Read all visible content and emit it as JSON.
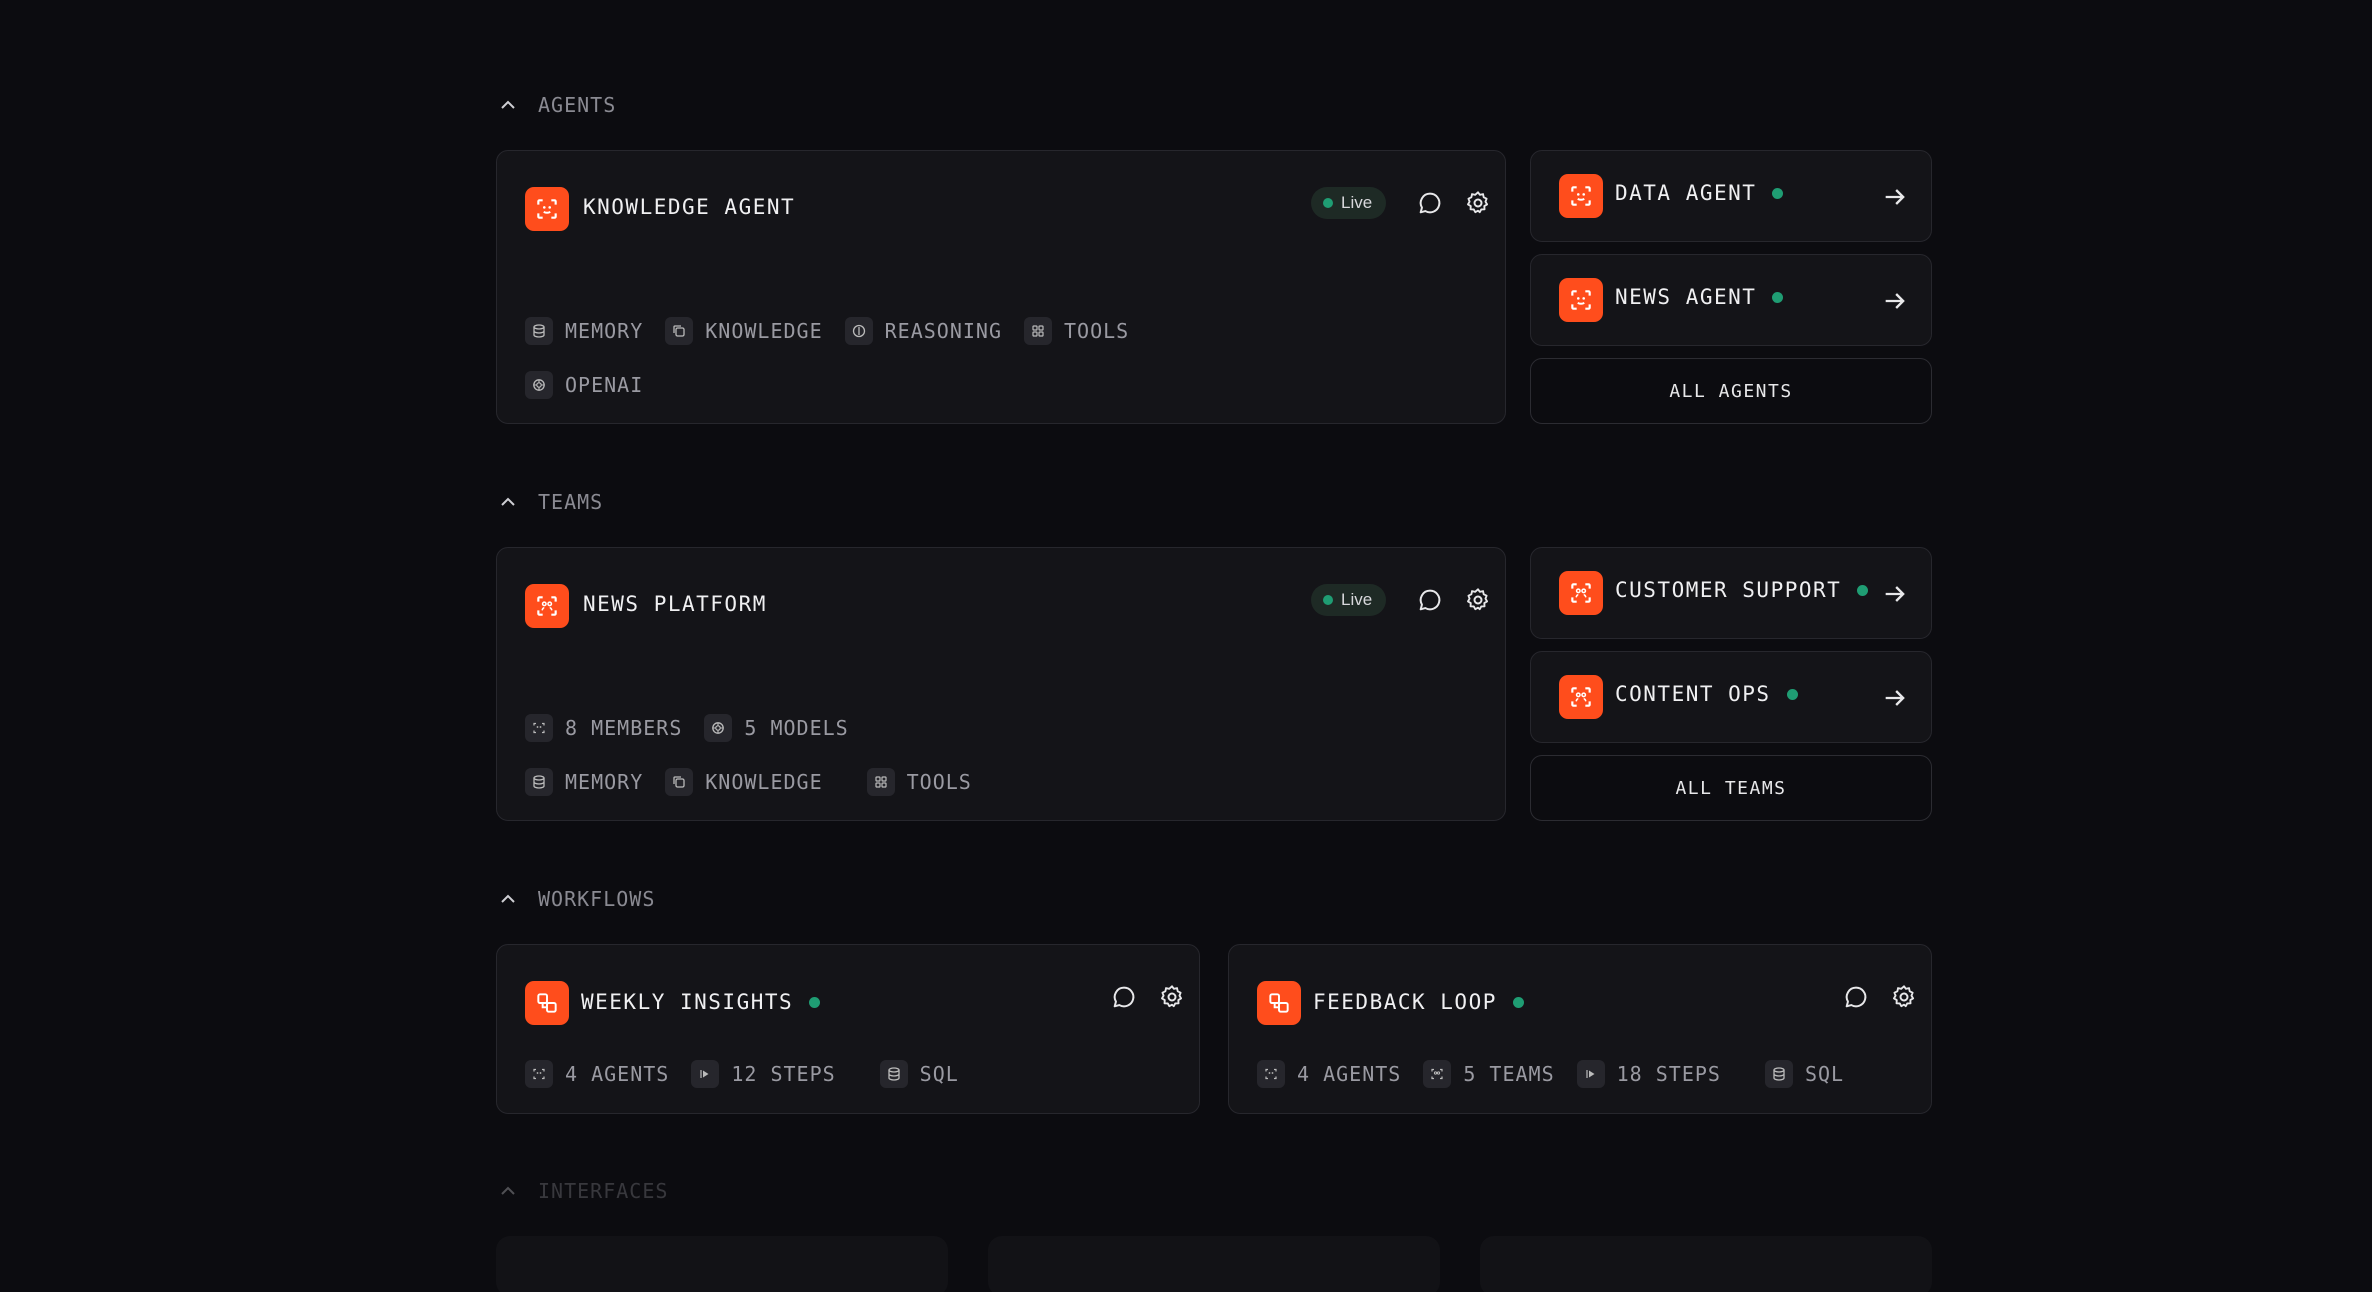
{
  "agents": {
    "section_label": "AGENTS",
    "main": {
      "title": "KNOWLEDGE AGENT",
      "status": "Live",
      "tags": [
        "MEMORY",
        "KNOWLEDGE",
        "REASONING",
        "TOOLS"
      ],
      "model": "OPENAI"
    },
    "side": [
      {
        "title": "DATA AGENT"
      },
      {
        "title": "NEWS AGENT"
      }
    ],
    "all_button": "ALL AGENTS"
  },
  "teams": {
    "section_label": "TEAMS",
    "main": {
      "title": "NEWS PLATFORM",
      "status": "Live",
      "members": "8 MEMBERS",
      "models": "5 MODELS",
      "tags": [
        "MEMORY",
        "KNOWLEDGE",
        "TOOLS"
      ]
    },
    "side": [
      {
        "title": "CUSTOMER SUPPORT"
      },
      {
        "title": "CONTENT OPS"
      }
    ],
    "all_button": "ALL TEAMS"
  },
  "workflows": {
    "section_label": "WORKFLOWS",
    "items": [
      {
        "title": "WEEKLY INSIGHTS",
        "tags": [
          "4 AGENTS",
          "12 STEPS",
          "SQL"
        ]
      },
      {
        "title": "FEEDBACK LOOP",
        "tags": [
          "4 AGENTS",
          "5 TEAMS",
          "18 STEPS",
          "SQL"
        ]
      }
    ]
  },
  "interfaces": {
    "section_label": "INTERFACES"
  },
  "colors": {
    "accent": "#ff4d1c",
    "status_green": "#1f9d73",
    "background": "#0c0c10",
    "card": "#141418"
  }
}
